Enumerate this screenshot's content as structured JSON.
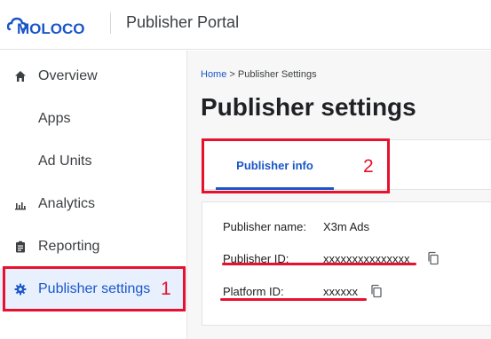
{
  "header": {
    "logo_text": "MOLOCO",
    "app_title": "Publisher Portal"
  },
  "sidebar": {
    "items": [
      {
        "label": "Overview",
        "icon": "home-icon"
      },
      {
        "label": "Apps",
        "icon": ""
      },
      {
        "label": "Ad Units",
        "icon": ""
      },
      {
        "label": "Analytics",
        "icon": "bar-chart-icon"
      },
      {
        "label": "Reporting",
        "icon": "clipboard-icon"
      },
      {
        "label": "Publisher settings",
        "icon": "gear-icon",
        "active": true
      }
    ]
  },
  "breadcrumb": {
    "home": "Home",
    "separator": ">",
    "current": "Publisher Settings"
  },
  "page": {
    "title": "Publisher settings"
  },
  "tabs": [
    {
      "label": "Publisher info",
      "active": true
    }
  ],
  "publisher_info": {
    "name_label": "Publisher name:",
    "name_value": "X3m Ads",
    "id_label": "Publisher ID:",
    "id_value": "xxxxxxxxxxxxxxx",
    "platform_label": "Platform ID:",
    "platform_value": "xxxxxx"
  },
  "annotations": {
    "marker_1": "1",
    "marker_2": "2",
    "color": "#e8112d"
  },
  "colors": {
    "accent": "#1a56c9",
    "active_bg": "#e8f0fe"
  }
}
